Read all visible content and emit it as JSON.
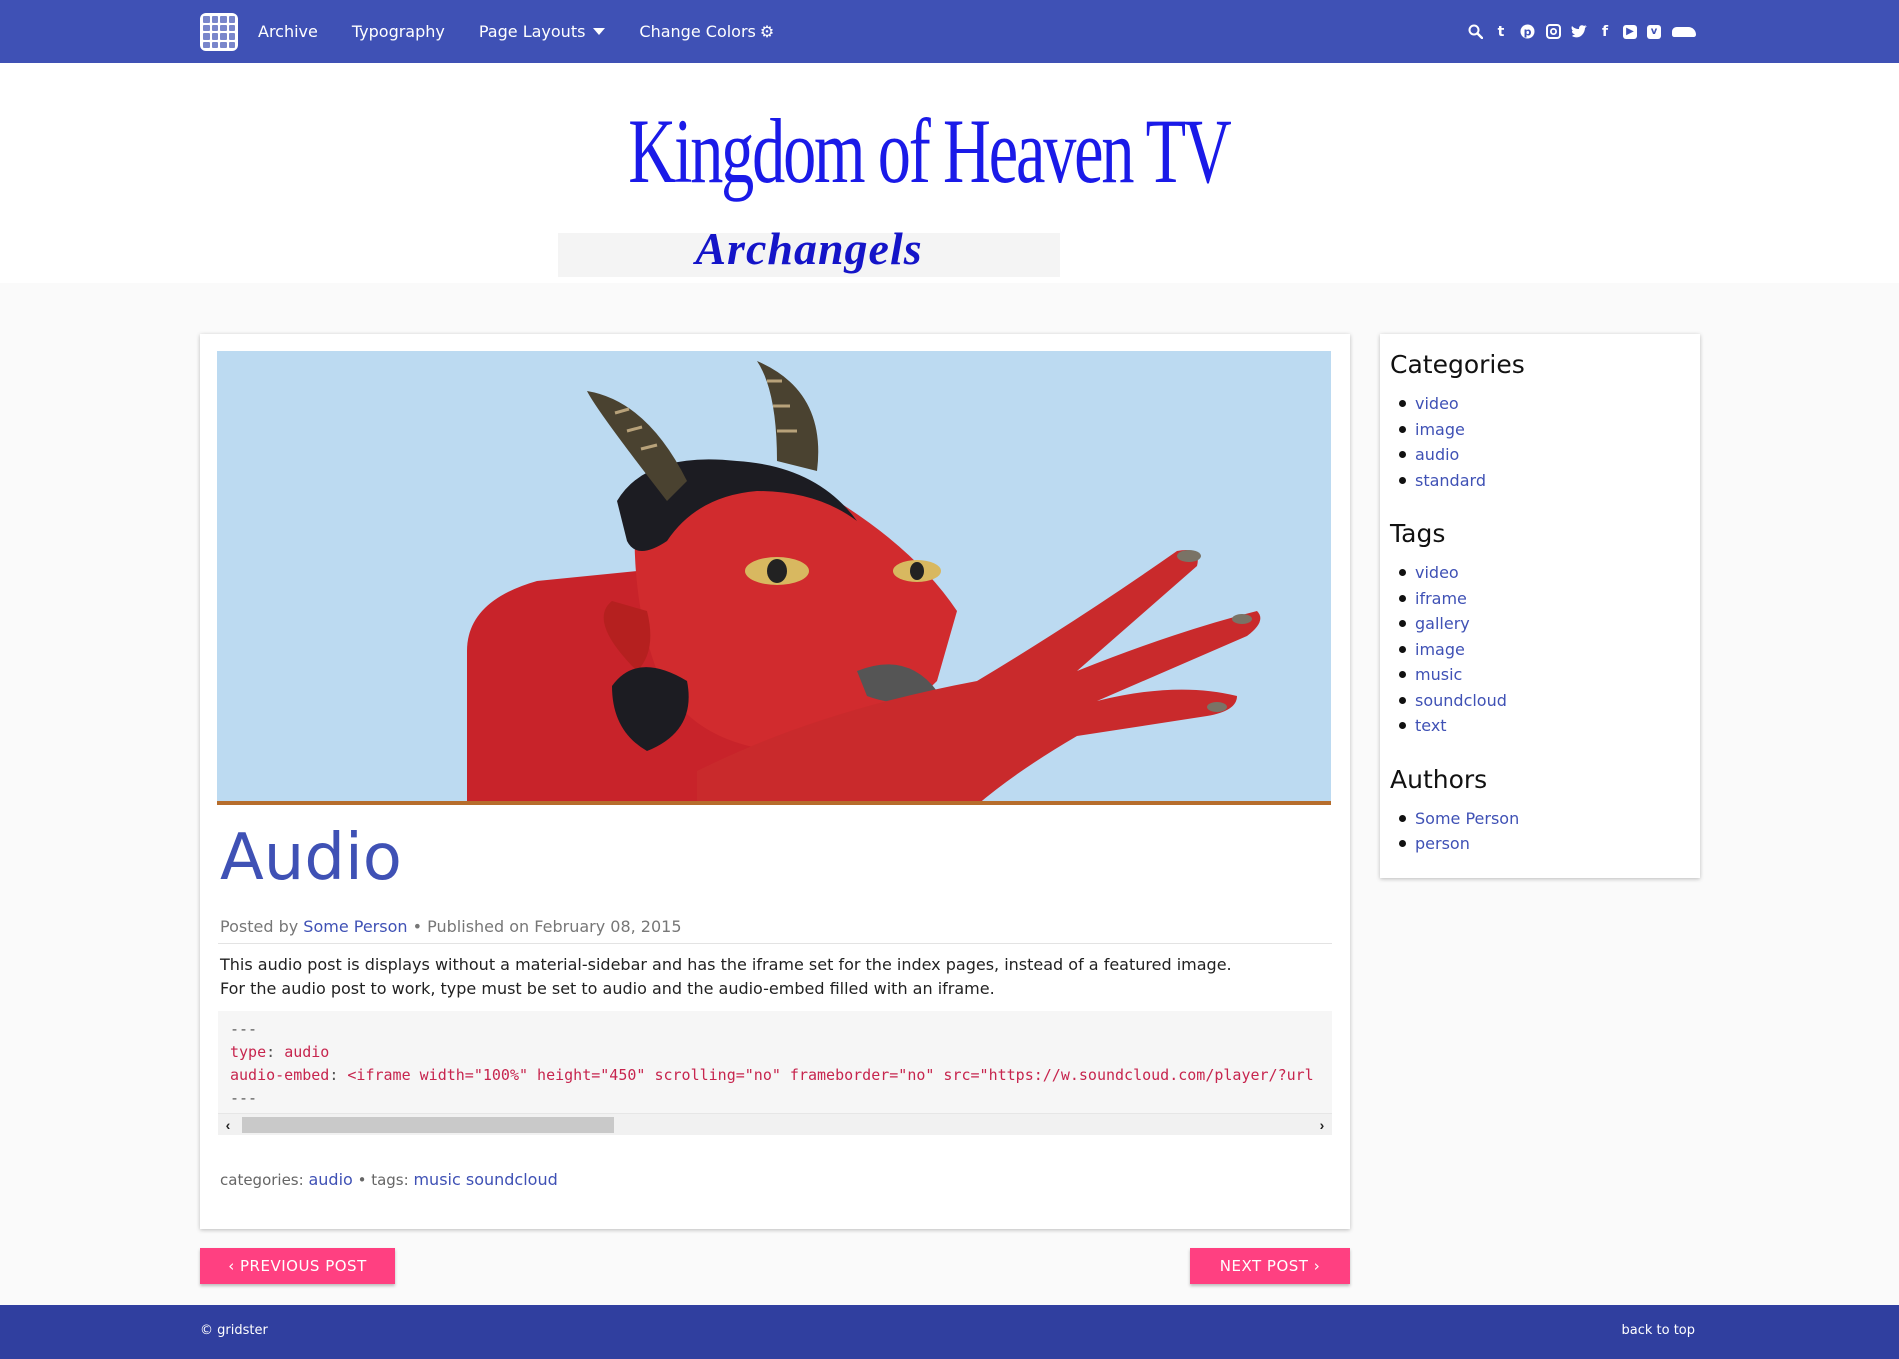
{
  "nav": {
    "links": [
      "Archive",
      "Typography",
      "Page Layouts",
      "Change Colors"
    ],
    "social_icons": [
      "search-icon",
      "tumblr-icon",
      "pinterest-icon",
      "instagram-icon",
      "twitter-icon",
      "facebook-icon",
      "youtube-icon",
      "vimeo-icon",
      "soundcloud-icon"
    ],
    "accent_color": "#3f51b5"
  },
  "header": {
    "logo_title": "Kingdom of Heaven TV",
    "logo_subtitle": "Archangels"
  },
  "post": {
    "title": "Audio",
    "meta": {
      "posted_by_label": "Posted by",
      "author": "Some Person",
      "published_label": "• Published on",
      "date": "February 08, 2015"
    },
    "body": [
      "This audio post is displays without a material-sidebar and has the iframe set for the index pages, instead of a featured image.",
      "For the audio post to work, type must be set to audio and the audio-embed filled with an iframe."
    ],
    "code": {
      "line1": "---",
      "type_key": "type",
      "type_val": "audio",
      "embed_key": "audio-embed",
      "embed_val": "<iframe width=\"100%\" height=\"450\" scrolling=\"no\" frameborder=\"no\" src=\"https://w.soundcloud.com/player/?url",
      "line4": "---"
    },
    "footer": {
      "categories_label": "categories:",
      "category": "audio",
      "tags_label": "• tags:",
      "tags": "music soundcloud"
    }
  },
  "sidebar": {
    "categories_title": "Categories",
    "categories": [
      "video",
      "image",
      "audio",
      "standard"
    ],
    "tags_title": "Tags",
    "tags": [
      "video",
      "iframe",
      "gallery",
      "image",
      "music",
      "soundcloud",
      "text"
    ],
    "authors_title": "Authors",
    "authors": [
      "Some Person",
      "person"
    ]
  },
  "pager": {
    "prev": "‹ PREVIOUS POST",
    "next": "NEXT POST ›",
    "button_color": "#ff4081"
  },
  "site_footer": {
    "copyright": "© gridster",
    "back_to_top": "back to top"
  }
}
